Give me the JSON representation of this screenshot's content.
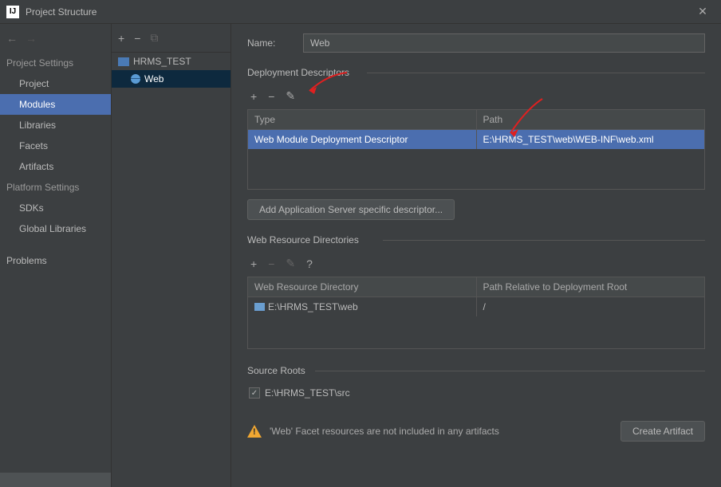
{
  "titlebar": {
    "title": "Project Structure"
  },
  "sidebar": {
    "project_settings_header": "Project Settings",
    "platform_settings_header": "Platform Settings",
    "items_project": "Project",
    "items_modules": "Modules",
    "items_libraries": "Libraries",
    "items_facets": "Facets",
    "items_artifacts": "Artifacts",
    "items_sdks": "SDKs",
    "items_global_libs": "Global Libraries",
    "items_problems": "Problems"
  },
  "tree": {
    "module": "HRMS_TEST",
    "facet": "Web"
  },
  "form": {
    "name_label": "Name:",
    "name_value": "Web"
  },
  "deployment": {
    "section_label": "Deployment Descriptors",
    "col_type": "Type",
    "col_path": "Path",
    "row_type": "Web Module Deployment Descriptor",
    "row_path": "E:\\HRMS_TEST\\web\\WEB-INF\\web.xml",
    "add_server_btn": "Add Application Server specific descriptor..."
  },
  "web_resources": {
    "section_label": "Web Resource Directories",
    "col_dir": "Web Resource Directory",
    "col_rel": "Path Relative to Deployment Root",
    "row_dir": "E:\\HRMS_TEST\\web",
    "row_rel": "/"
  },
  "source_roots": {
    "section_label": "Source Roots",
    "item": "E:\\HRMS_TEST\\src"
  },
  "warning": {
    "text": "'Web' Facet resources are not included in any artifacts",
    "btn": "Create Artifact"
  }
}
